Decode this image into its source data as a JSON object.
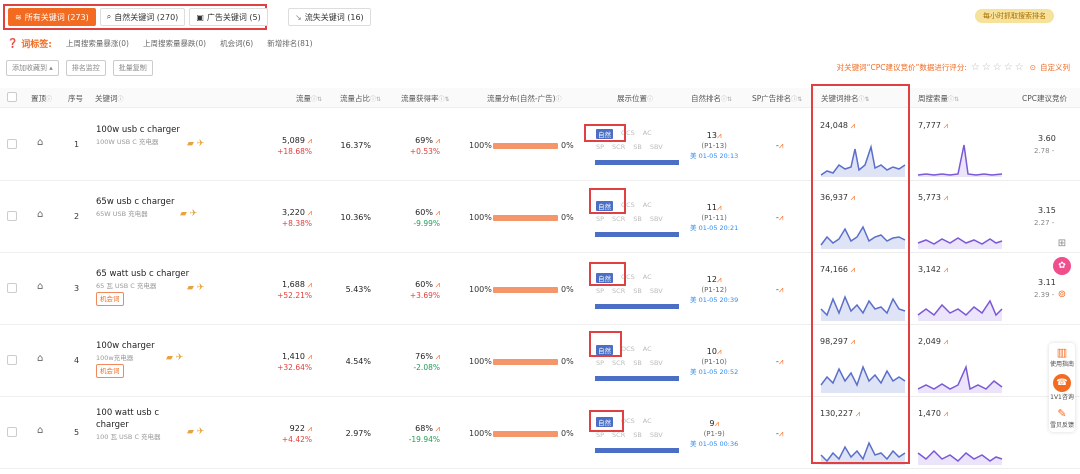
{
  "tabs": [
    {
      "label": "所有关键词 (273)",
      "icon": "layers-icon",
      "active": true
    },
    {
      "label": "自然关键词 (270)",
      "icon": "search-icon",
      "active": false
    },
    {
      "label": "广告关键词 (5)",
      "icon": "ad-icon",
      "active": false
    }
  ],
  "tab_lost": {
    "label": "流失关键词 (16)",
    "icon": "trend-down-icon"
  },
  "hourly_badge": "每小时抓取搜索排名",
  "tag_row": {
    "label": "词标签:",
    "items": [
      "上周搜索量暴涨(0)",
      "上周搜索量暴跌(0)",
      "机会词(6)",
      "新增排名(81)"
    ]
  },
  "toolbar": {
    "add_favorite": "添加收藏到 ▴",
    "rank_monitor": "排名监控",
    "batch_copy": "批量复制"
  },
  "rating": {
    "text": "对关键词“CPC建议竞价”数据进行评分:",
    "stars": "☆☆☆☆☆",
    "custom_col": "自定义列"
  },
  "columns": {
    "pin": "置顶",
    "no": "序号",
    "keyword": "关键词",
    "traffic": "流量",
    "share": "流量占比",
    "rate": "流量获得率",
    "distribution": "流量分布(自然-广告)",
    "position": "展示位置",
    "natural_rank": "自然排名",
    "sp_rank": "SP广告排名",
    "kw_rank": "关键词排名",
    "weekly_search": "周搜索量",
    "cpc": "CPC建议竞价"
  },
  "position_labels": {
    "row1": [
      "自然",
      "OCS",
      "AC"
    ],
    "row2": [
      "SP",
      "SCR",
      "SB",
      "SBV"
    ]
  },
  "rows": [
    {
      "no": "1",
      "keyword": "100w usb c charger",
      "kw_cn": "100W USB C 充电器",
      "chance": "",
      "traffic": "5,089",
      "traffic_change": "+18.68%",
      "share": "16.37%",
      "rate": "69%",
      "rate_change": "+0.53%",
      "rate_dir": "up",
      "dist_left": "100%",
      "dist_right": "0%",
      "nat_rank": "13",
      "nat_page": "(P1-13)",
      "nat_time": "美 01-05 20:13",
      "sp_rank": "-",
      "kw_rank_value": "24,048",
      "weekly": "7,777",
      "cpc": "3.60",
      "cpc_range": "2.78 -"
    },
    {
      "no": "2",
      "keyword": "65w usb c charger",
      "kw_cn": "65W USB 充电器",
      "chance": "",
      "traffic": "3,220",
      "traffic_change": "+8.38%",
      "share": "10.36%",
      "rate": "60%",
      "rate_change": "-9.99%",
      "rate_dir": "down",
      "dist_left": "100%",
      "dist_right": "0%",
      "nat_rank": "11",
      "nat_page": "(P1-11)",
      "nat_time": "美 01-05 20:21",
      "sp_rank": "-",
      "kw_rank_value": "36,937",
      "weekly": "5,773",
      "cpc": "3.15",
      "cpc_range": "2.27 -"
    },
    {
      "no": "3",
      "keyword": "65 watt usb c charger",
      "kw_cn": "65 瓦 USB C 充电器",
      "chance": "机会词",
      "traffic": "1,688",
      "traffic_change": "+52.21%",
      "share": "5.43%",
      "rate": "60%",
      "rate_change": "+3.69%",
      "rate_dir": "up",
      "dist_left": "100%",
      "dist_right": "0%",
      "nat_rank": "12",
      "nat_page": "(P1-12)",
      "nat_time": "美 01-05 20:39",
      "sp_rank": "-",
      "kw_rank_value": "74,166",
      "weekly": "3,142",
      "cpc": "3.11",
      "cpc_range": "2.39 -"
    },
    {
      "no": "4",
      "keyword": "100w charger",
      "kw_cn": "100w充电器",
      "chance": "机会词",
      "traffic": "1,410",
      "traffic_change": "+32.64%",
      "share": "4.54%",
      "rate": "76%",
      "rate_change": "-2.08%",
      "rate_dir": "down",
      "dist_left": "100%",
      "dist_right": "0%",
      "nat_rank": "10",
      "nat_page": "(P1-10)",
      "nat_time": "美 01-05 20:52",
      "sp_rank": "-",
      "kw_rank_value": "98,297",
      "weekly": "2,049",
      "cpc": "",
      "cpc_range": ""
    },
    {
      "no": "5",
      "keyword": "100 watt usb c",
      "keyword2": "charger",
      "kw_cn": "100 瓦 USB C 充电器",
      "chance": "",
      "traffic": "922",
      "traffic_change": "+4.42%",
      "share": "2.97%",
      "rate": "68%",
      "rate_change": "-19.94%",
      "rate_dir": "down",
      "dist_left": "100%",
      "dist_right": "0%",
      "nat_rank": "9",
      "nat_page": "(P1-9)",
      "nat_time": "美 01-05 00:36",
      "sp_rank": "-",
      "kw_rank_value": "130,227",
      "weekly": "1,470",
      "cpc": "",
      "cpc_range": ""
    }
  ],
  "right_panel": [
    {
      "label": "使用指南",
      "icon": "book-icon",
      "color": "#f26b21"
    },
    {
      "label": "1V1咨询",
      "icon": "headset-icon",
      "color": "#f26b21"
    },
    {
      "label": "雪贝反馈",
      "icon": "edit-icon",
      "color": "#f26b21"
    }
  ]
}
